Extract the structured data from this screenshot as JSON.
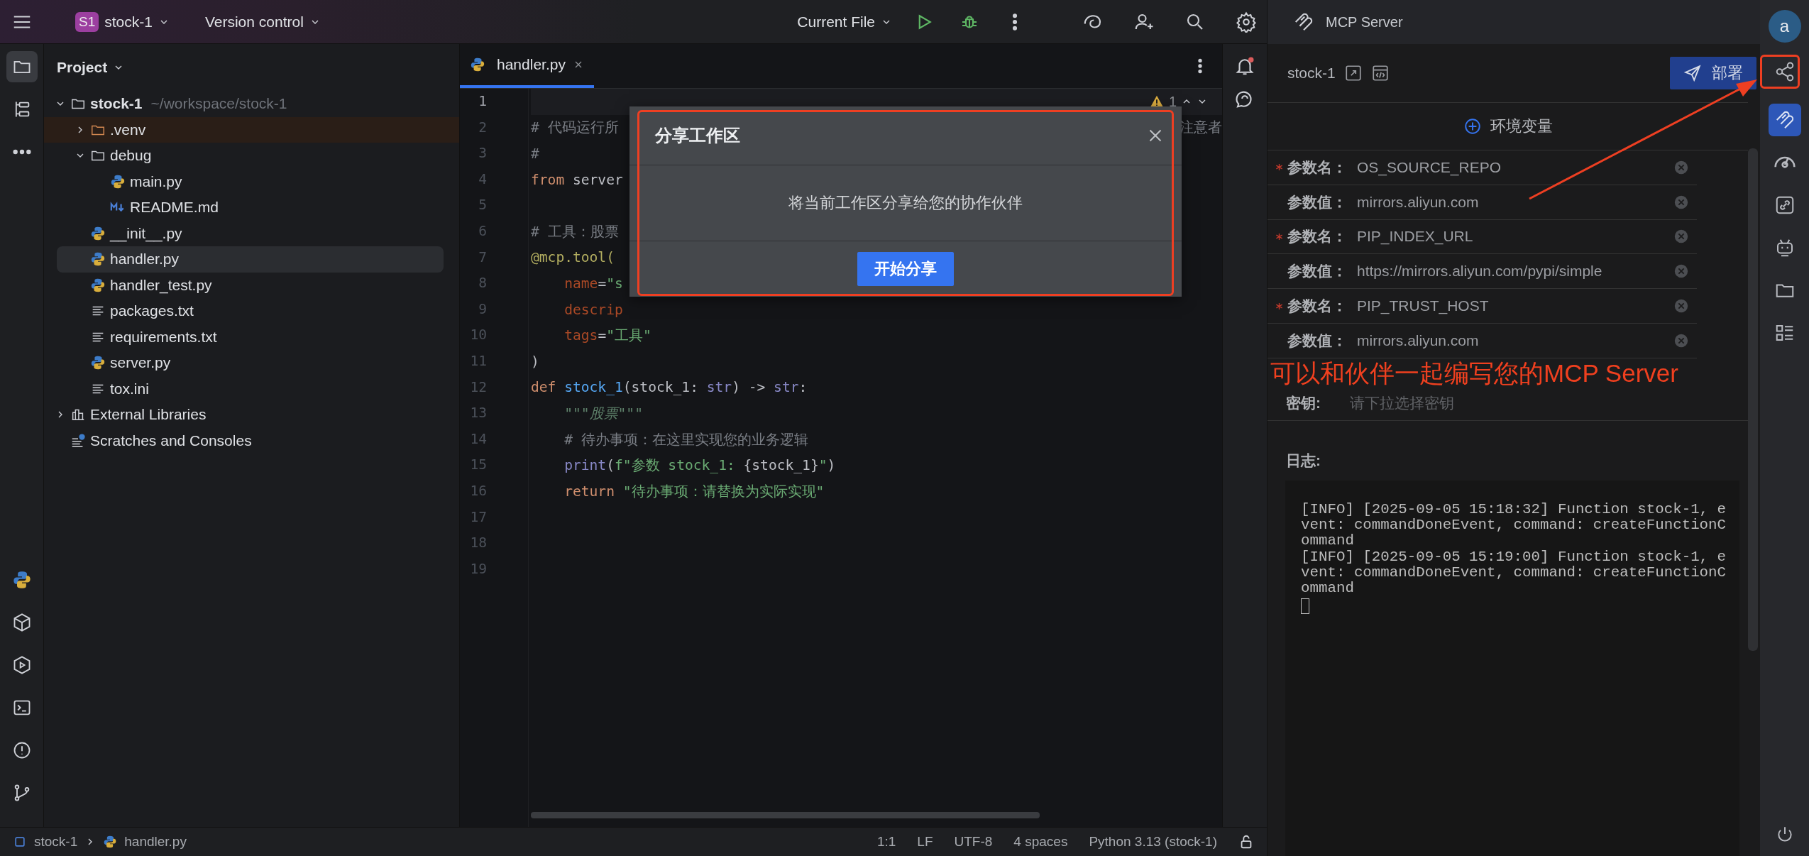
{
  "top_bar": {
    "project_badge": "S1",
    "project": "stock-1",
    "vcs": "Version control",
    "run_config": "Current File"
  },
  "left_toolbar": {
    "top": [
      {
        "kind": "folder",
        "selected": true
      },
      {
        "kind": "structure",
        "selected": false
      },
      {
        "kind": "more",
        "selected": false
      }
    ],
    "bottom": [
      {
        "kind": "python"
      },
      {
        "kind": "package"
      },
      {
        "kind": "run"
      },
      {
        "kind": "terminal"
      },
      {
        "kind": "problems"
      },
      {
        "kind": "git"
      }
    ]
  },
  "project_panel": {
    "title": "Project",
    "tree": [
      {
        "label": "stock-1",
        "path": "~/workspace/stock-1",
        "kind": "folder",
        "expanded": true,
        "selected": false,
        "excluded": false,
        "children": [
          {
            "label": ".venv",
            "kind": "folder",
            "expanded": false,
            "selected": false,
            "excluded": true
          },
          {
            "label": "debug",
            "kind": "folder",
            "expanded": true,
            "selected": false,
            "excluded": false,
            "children": [
              {
                "label": "main.py",
                "kind": "python",
                "selected": false,
                "excluded": false
              },
              {
                "label": "README.md",
                "kind": "markdown",
                "selected": false,
                "excluded": false
              }
            ]
          },
          {
            "label": "__init__.py",
            "kind": "python",
            "selected": false,
            "excluded": false
          },
          {
            "label": "handler.py",
            "kind": "python",
            "selected": true,
            "excluded": false
          },
          {
            "label": "handler_test.py",
            "kind": "python",
            "selected": false,
            "excluded": false
          },
          {
            "label": "packages.txt",
            "kind": "text",
            "selected": false,
            "excluded": false
          },
          {
            "label": "requirements.txt",
            "kind": "text",
            "selected": false,
            "excluded": false
          },
          {
            "label": "server.py",
            "kind": "python",
            "selected": false,
            "excluded": false
          },
          {
            "label": "tox.ini",
            "kind": "text",
            "selected": false,
            "excluded": false
          }
        ]
      },
      {
        "label": "External Libraries",
        "kind": "library",
        "expanded": false,
        "selected": false,
        "excluded": false
      },
      {
        "label": "Scratches and Consoles",
        "kind": "scratches",
        "selected": false,
        "excluded": false
      }
    ]
  },
  "editor": {
    "tabs": [
      {
        "label": "handler.py",
        "selected": true
      }
    ],
    "problems": "1",
    "lines": [
      {
        "number": "1",
        "current": true
      },
      {
        "number": "2",
        "current": false,
        "tokens": [
          {
            "text": "# 代码运行所",
            "kind": "comment"
          }
        ],
        "tail": "注意者"
      },
      {
        "number": "3",
        "current": false,
        "tokens": [
          {
            "text": "#",
            "kind": "comment"
          }
        ]
      },
      {
        "number": "4",
        "current": false,
        "tokens": [
          {
            "text": "from",
            "kind": "keyword"
          },
          {
            "text": " server",
            "kind": "plain"
          }
        ]
      },
      {
        "number": "5",
        "current": false
      },
      {
        "number": "6",
        "current": false,
        "tokens": [
          {
            "text": "# 工具：股票",
            "kind": "comment"
          }
        ]
      },
      {
        "number": "7",
        "current": false,
        "tokens": [
          {
            "text": "@mcp.tool(",
            "kind": "decorator"
          }
        ]
      },
      {
        "number": "8",
        "current": false,
        "tokens": [
          {
            "text": "    name",
            "kind": "param"
          },
          {
            "text": "=",
            "kind": "plain"
          },
          {
            "text": "\"s",
            "kind": "string"
          }
        ]
      },
      {
        "number": "9",
        "current": false,
        "tokens": [
          {
            "text": "    descrip",
            "kind": "param"
          }
        ]
      },
      {
        "number": "10",
        "current": false,
        "tokens": [
          {
            "text": "    tags",
            "kind": "param"
          },
          {
            "text": "=",
            "kind": "plain"
          },
          {
            "text": "\"工具\"",
            "kind": "string"
          }
        ]
      },
      {
        "number": "11",
        "current": false,
        "tokens": [
          {
            "text": ")",
            "kind": "plain"
          }
        ]
      },
      {
        "number": "12",
        "current": false,
        "tokens": [
          {
            "text": "def ",
            "kind": "keyword"
          },
          {
            "text": "stock_1",
            "kind": "function"
          },
          {
            "text": "(stock_1: ",
            "kind": "plain"
          },
          {
            "text": "str",
            "kind": "builtin"
          },
          {
            "text": ") -> ",
            "kind": "plain"
          },
          {
            "text": "str",
            "kind": "builtin"
          },
          {
            "text": ":",
            "kind": "plain"
          }
        ]
      },
      {
        "number": "13",
        "current": false,
        "tokens": [
          {
            "text": "    \"\"\"股票\"\"\"",
            "kind": "docstring"
          }
        ]
      },
      {
        "number": "14",
        "current": false,
        "tokens": [
          {
            "text": "    # 待办事项：在这里实现您的业务逻辑",
            "kind": "comment"
          }
        ]
      },
      {
        "number": "15",
        "current": false,
        "tokens": [
          {
            "text": "    print",
            "kind": "builtin"
          },
          {
            "text": "(",
            "kind": "plain"
          },
          {
            "text": "f\"参数 stock_1: ",
            "kind": "string"
          },
          {
            "text": "{stock_1}",
            "kind": "plain"
          },
          {
            "text": "\"",
            "kind": "string"
          },
          {
            "text": ")",
            "kind": "plain"
          }
        ]
      },
      {
        "number": "16",
        "current": false,
        "tokens": [
          {
            "text": "    return ",
            "kind": "keyword"
          },
          {
            "text": "\"待办事项：请替换为实际实现\"",
            "kind": "string"
          }
        ]
      },
      {
        "number": "17",
        "current": false
      },
      {
        "number": "18",
        "current": false
      },
      {
        "number": "19",
        "current": false
      }
    ]
  },
  "dialog": {
    "title": "分享工作区",
    "message": "将当前工作区分享给您的协作伙伴",
    "button": "开始分享"
  },
  "mcp_panel": {
    "title": "MCP Server",
    "server": "stock-1",
    "deploy": "部署",
    "env_title": "环境变量",
    "env_rows": [
      {
        "label": "参数名：",
        "value": "OS_SOURCE_REPO",
        "required": true
      },
      {
        "label": "参数值：",
        "value": "mirrors.aliyun.com",
        "required": false
      },
      {
        "label": "参数名：",
        "value": "PIP_INDEX_URL",
        "required": true
      },
      {
        "label": "参数值：",
        "value": "https://mirrors.aliyun.com/pypi/simple",
        "required": false
      },
      {
        "label": "参数名：",
        "value": "PIP_TRUST_HOST",
        "required": true
      },
      {
        "label": "参数值：",
        "value": "mirrors.aliyun.com",
        "required": false
      }
    ],
    "secret_label": "密钥:",
    "secret_placeholder": "请下拉选择密钥",
    "log_label": "日志:",
    "log": [
      "[INFO] [2025-09-05 15:18:32] Function stock-1, event: commandDoneEvent, command: createFunctionCommand",
      "[INFO] [2025-09-05 15:19:00] Function stock-1, event: commandDoneEvent, command: createFunctionCommand"
    ]
  },
  "right_toolbar": {
    "avatar": "a",
    "tools": [
      {
        "kind": "share",
        "selected": false
      },
      {
        "kind": "mcp",
        "selected": true
      },
      {
        "kind": "gauge",
        "selected": false
      },
      {
        "kind": "link",
        "selected": false
      },
      {
        "kind": "robot",
        "selected": false
      },
      {
        "kind": "folder",
        "selected": false
      },
      {
        "kind": "list",
        "selected": false
      }
    ]
  },
  "status_bar": {
    "breadcrumbs": [
      "stock-1",
      "handler.py"
    ],
    "items": [
      "1:1",
      "LF",
      "UTF-8",
      "4 spaces",
      "Python 3.13 (stock-1)"
    ]
  },
  "annotation": {
    "text": "可以和伙伴一起编写您的MCP Server"
  }
}
